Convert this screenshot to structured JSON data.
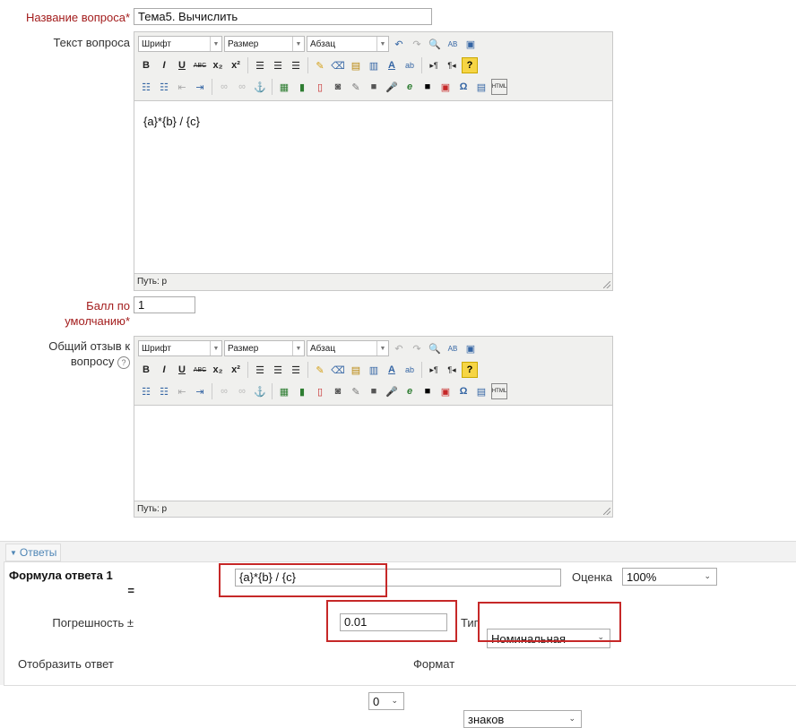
{
  "question_name": {
    "label": "Название вопроса",
    "required": "*",
    "value": "Тема5. Вычислить"
  },
  "question_text": {
    "label": "Текст вопроса",
    "content": "{a}*{b} / {c}",
    "path": "Путь: p"
  },
  "editor": {
    "font": "Шрифт",
    "size": "Размер",
    "paragraph": "Абзац"
  },
  "default_mark": {
    "label1": "Балл по",
    "label2": "умолчанию",
    "required": "*",
    "value": "1"
  },
  "general_feedback": {
    "label1": "Общий отзыв к",
    "label2": "вопросу",
    "content": "",
    "path": "Путь: p"
  },
  "answers": {
    "section_title": "Ответы",
    "formula_label": "Формула ответа 1",
    "formula_label2": "=",
    "formula_value": "{a}*{b} / {c}",
    "grade_label": "Оценка",
    "grade_value": "100%",
    "tolerance_label": "Погрешность ±",
    "tolerance_value": "0.01",
    "type_label": "Тип",
    "type_value": "Номинальная",
    "display_label": "Отобразить ответ",
    "display_value": "0",
    "format_label": "Формат",
    "format_value": "знаков"
  },
  "colors": {
    "required": "#a31d1d",
    "highlight": "#c62828",
    "section_bg": "#f2f2f2"
  }
}
